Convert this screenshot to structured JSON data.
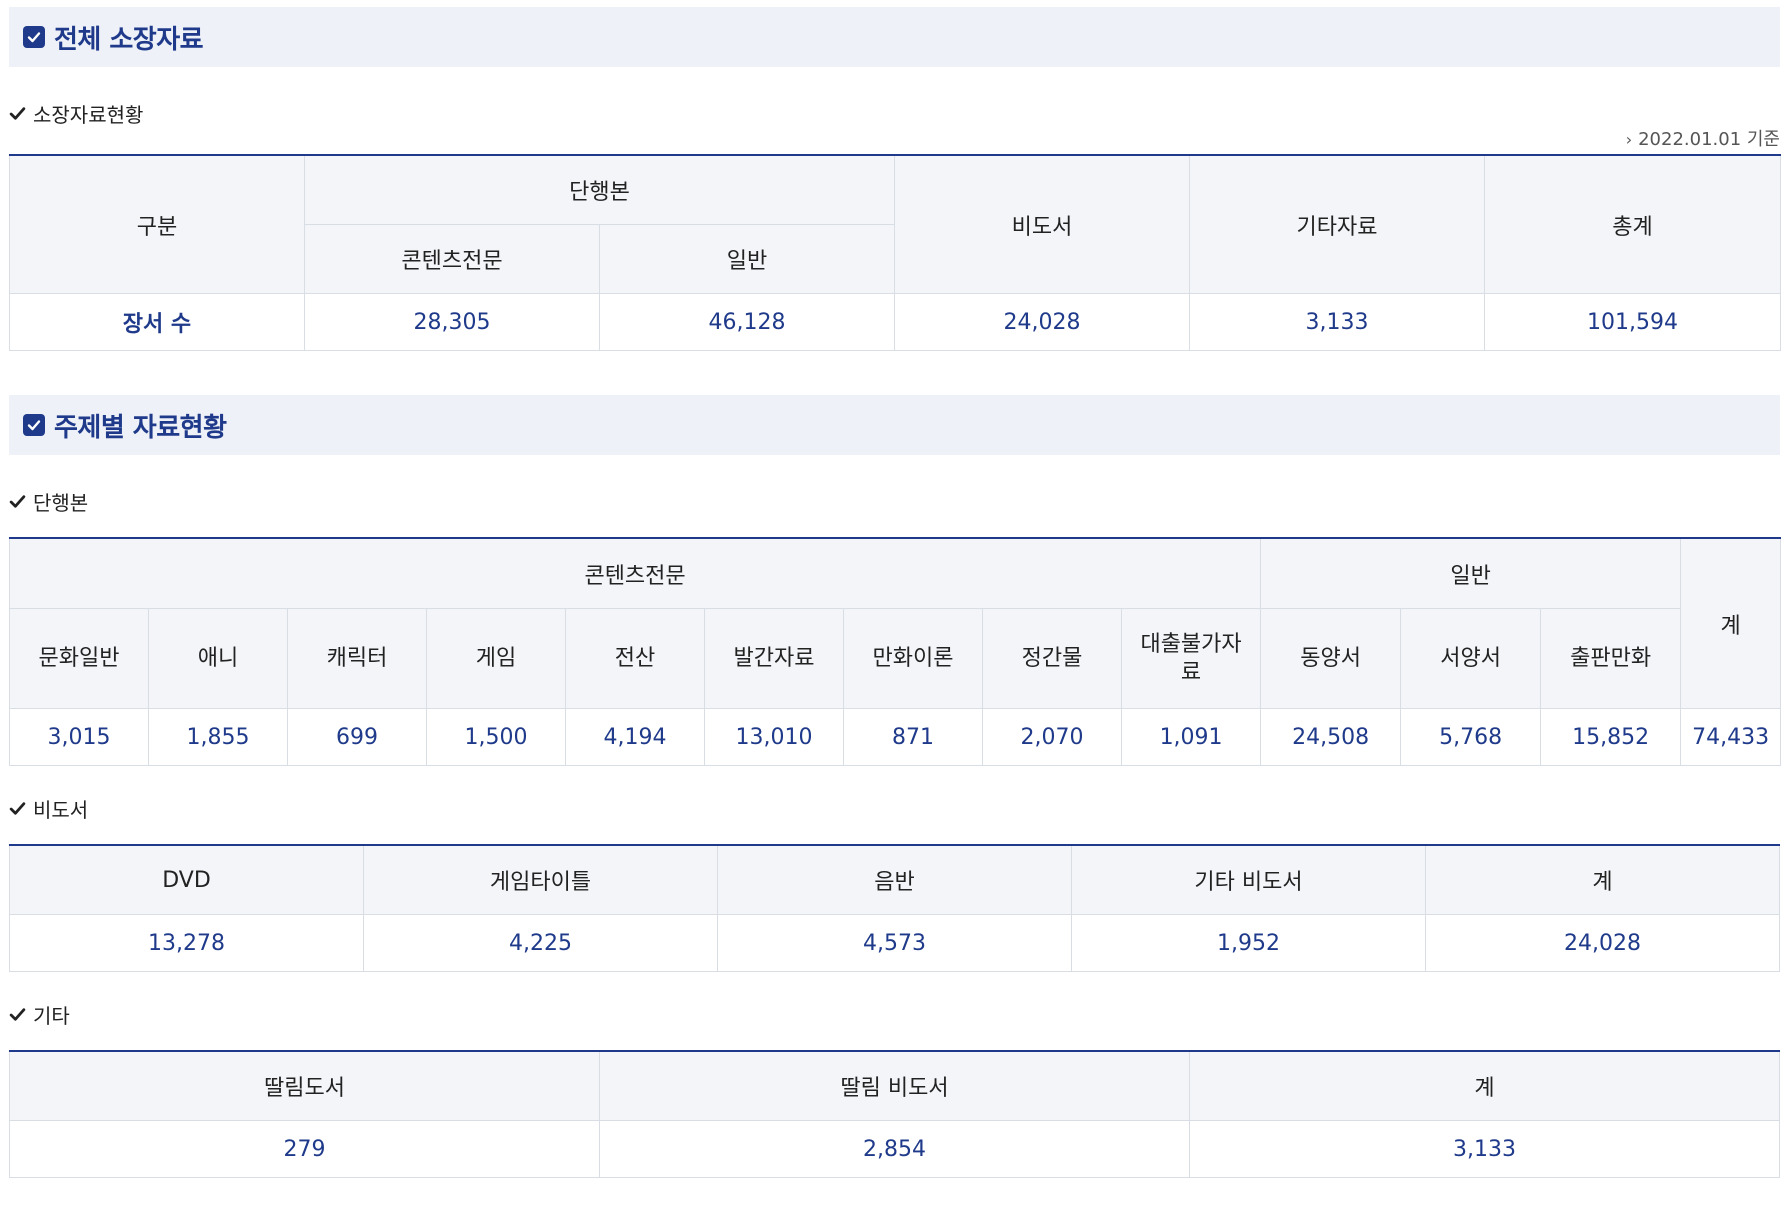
{
  "sections": {
    "holdings_title": "전체 소장자료",
    "subject_title": "주제별 자료현황"
  },
  "holdings": {
    "subtitle": "소장자료현황",
    "date_note": "2022.01.01 기준",
    "headers": {
      "category": "구분",
      "books": "단행본",
      "contents": "콘텐츠전문",
      "general": "일반",
      "nonbook": "비도서",
      "other": "기타자료",
      "total": "총계"
    },
    "row": {
      "label": "장서 수",
      "contents": "28,305",
      "general": "46,128",
      "nonbook": "24,028",
      "other": "3,133",
      "total": "101,594"
    }
  },
  "books": {
    "subtitle": "단행본",
    "group_contents": "콘텐츠전문",
    "group_general": "일반",
    "total_header": "계",
    "columns": [
      "문화일반",
      "애니",
      "캐릭터",
      "게임",
      "전산",
      "발간자료",
      "만화이론",
      "정간물",
      "대출불가자료",
      "동양서",
      "서양서",
      "출판만화"
    ],
    "values": [
      "3,015",
      "1,855",
      "699",
      "1,500",
      "4,194",
      "13,010",
      "871",
      "2,070",
      "1,091",
      "24,508",
      "5,768",
      "15,852"
    ],
    "total": "74,433"
  },
  "nonbook": {
    "subtitle": "비도서",
    "columns": [
      "DVD",
      "게임타이틀",
      "음반",
      "기타 비도서",
      "계"
    ],
    "values": [
      "13,278",
      "4,225",
      "4,573",
      "1,952",
      "24,028"
    ]
  },
  "other": {
    "subtitle": "기타",
    "columns": [
      "딸림도서",
      "딸림 비도서",
      "계"
    ],
    "values": [
      "279",
      "2,854",
      "3,133"
    ]
  }
}
